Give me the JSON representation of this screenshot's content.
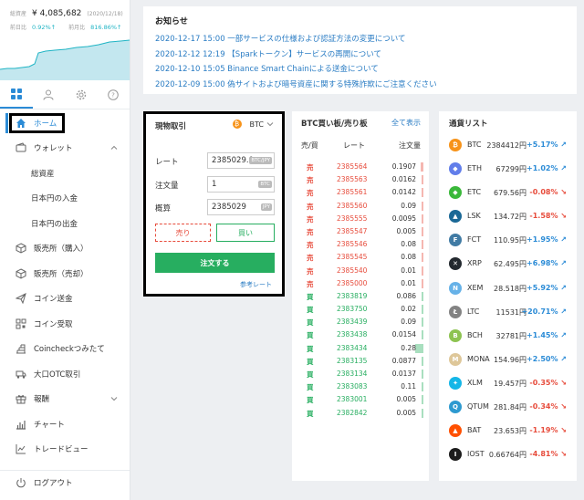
{
  "account": {
    "total_label": "総資産",
    "total_value": "¥ 4,085,682",
    "total_date": "(2020/12/18)",
    "day_label": "前日比",
    "day_pct": "0.92%↑",
    "month_label": "前月比",
    "month_pct": "816.86%↑"
  },
  "nav": {
    "home": "ホーム",
    "wallet": "ウォレット",
    "wallet_sub": [
      "総資産",
      "日本円の入金",
      "日本円の出金"
    ],
    "buy_shop": "販売所（購入）",
    "sell_shop": "販売所（売却）",
    "send": "コイン送金",
    "receive": "コイン受取",
    "tsumitate": "Coincheckつみたて",
    "otc": "大口OTC取引",
    "reward": "報酬",
    "chart": "チャート",
    "tradeview": "トレードビュー",
    "logout": "ログアウト"
  },
  "notice": {
    "title": "お知らせ",
    "items": [
      "2020-12-17 15:00 一部サービスの仕様および認証方法の変更について",
      "2020-12-12 12:19 【Sparkトークン】サービスの再開について",
      "2020-12-10 15:05 Binance Smart Chainによる送金について",
      "2020-12-09 15:00 偽サイトおよび暗号資産に関する特殊詐欺にご注意ください"
    ]
  },
  "trade": {
    "title": "現物取引",
    "coin": "BTC",
    "rate_label": "レート",
    "rate_value": "2385029.0",
    "rate_unit": "BTC/JPY",
    "qty_label": "注文量",
    "qty_value": "1",
    "qty_unit": "BTC",
    "conv_label": "概算",
    "conv_value": "2385029",
    "conv_unit": "JPY",
    "sell": "売り",
    "buy": "買い",
    "order": "注文する",
    "ref": "参考レート"
  },
  "book": {
    "title": "BTC買い板/売り板",
    "show_all": "全て表示",
    "col_side": "売/買",
    "col_rate": "レート",
    "col_qty": "注文量",
    "rows": [
      {
        "side": "売",
        "price": "2385564",
        "qty": "0.1907",
        "bar": 0.8
      },
      {
        "side": "売",
        "price": "2385563",
        "qty": "0.0162",
        "bar": 0.1
      },
      {
        "side": "売",
        "price": "2385561",
        "qty": "0.0142",
        "bar": 0.1
      },
      {
        "side": "売",
        "price": "2385560",
        "qty": "0.09",
        "bar": 0.5
      },
      {
        "side": "売",
        "price": "2385555",
        "qty": "0.0095",
        "bar": 0.1
      },
      {
        "side": "売",
        "price": "2385547",
        "qty": "0.005",
        "bar": 0.05
      },
      {
        "side": "売",
        "price": "2385546",
        "qty": "0.08",
        "bar": 0.45
      },
      {
        "side": "売",
        "price": "2385545",
        "qty": "0.08",
        "bar": 0.45
      },
      {
        "side": "売",
        "price": "2385540",
        "qty": "0.01",
        "bar": 0.1
      },
      {
        "side": "売",
        "price": "2385000",
        "qty": "0.01",
        "bar": 0.1
      },
      {
        "side": "買",
        "price": "2383819",
        "qty": "0.086",
        "bar": 0.5
      },
      {
        "side": "買",
        "price": "2383750",
        "qty": "0.02",
        "bar": 0.15
      },
      {
        "side": "買",
        "price": "2383439",
        "qty": "0.09",
        "bar": 0.5
      },
      {
        "side": "買",
        "price": "2383438",
        "qty": "0.0154",
        "bar": 0.1
      },
      {
        "side": "買",
        "price": "2383434",
        "qty": "0.28",
        "bar": 2.2
      },
      {
        "side": "買",
        "price": "2383135",
        "qty": "0.0877",
        "bar": 0.5
      },
      {
        "side": "買",
        "price": "2383134",
        "qty": "0.0137",
        "bar": 0.1
      },
      {
        "side": "買",
        "price": "2383083",
        "qty": "0.11",
        "bar": 0.6
      },
      {
        "side": "買",
        "price": "2383001",
        "qty": "0.005",
        "bar": 0.05
      },
      {
        "side": "買",
        "price": "2382842",
        "qty": "0.005",
        "bar": 0.05
      }
    ]
  },
  "currencies": {
    "title": "通貨リスト",
    "items": [
      {
        "sym": "BTC",
        "price": "2384412円",
        "chg": "+5.17%",
        "dir": "up",
        "color": "#f7931a",
        "icon": "bitcoin-icon",
        "glyph": "₿"
      },
      {
        "sym": "ETH",
        "price": "67299円",
        "chg": "+1.02%",
        "dir": "up",
        "color": "#627eea",
        "icon": "ethereum-icon",
        "glyph": "◆"
      },
      {
        "sym": "ETC",
        "price": "679.56円",
        "chg": "-0.08%",
        "dir": "down",
        "color": "#3ab83a",
        "icon": "ethereum-classic-icon",
        "glyph": "◆"
      },
      {
        "sym": "LSK",
        "price": "134.72円",
        "chg": "-1.58%",
        "dir": "down",
        "color": "#1a6896",
        "icon": "lisk-icon",
        "glyph": "▲"
      },
      {
        "sym": "FCT",
        "price": "110.95円",
        "chg": "+1.95%",
        "dir": "up",
        "color": "#417ba4",
        "icon": "factom-icon",
        "glyph": "F"
      },
      {
        "sym": "XRP",
        "price": "62.495円",
        "chg": "+6.98%",
        "dir": "up",
        "color": "#23292f",
        "icon": "ripple-icon",
        "glyph": "✕"
      },
      {
        "sym": "XEM",
        "price": "28.518円",
        "chg": "+5.92%",
        "dir": "up",
        "color": "#67b2e8",
        "icon": "nem-icon",
        "glyph": "N"
      },
      {
        "sym": "LTC",
        "price": "11531円",
        "chg": "+20.71%",
        "dir": "up",
        "color": "#838383",
        "icon": "litecoin-icon",
        "glyph": "Ł"
      },
      {
        "sym": "BCH",
        "price": "32781円",
        "chg": "+1.45%",
        "dir": "up",
        "color": "#8dc351",
        "icon": "bitcoin-cash-icon",
        "glyph": "B"
      },
      {
        "sym": "MONA",
        "price": "154.96円",
        "chg": "+2.50%",
        "dir": "up",
        "color": "#dec799",
        "icon": "monacoin-icon",
        "glyph": "M"
      },
      {
        "sym": "XLM",
        "price": "19.457円",
        "chg": "-0.35%",
        "dir": "down",
        "color": "#14b6e7",
        "icon": "stellar-icon",
        "glyph": "✦"
      },
      {
        "sym": "QTUM",
        "price": "281.84円",
        "chg": "-0.34%",
        "dir": "down",
        "color": "#2e9ad0",
        "icon": "qtum-icon",
        "glyph": "Q"
      },
      {
        "sym": "BAT",
        "price": "23.653円",
        "chg": "-1.19%",
        "dir": "down",
        "color": "#ff5000",
        "icon": "bat-icon",
        "glyph": "▲"
      },
      {
        "sym": "IOST",
        "price": "0.66764円",
        "chg": "-4.81%",
        "dir": "down",
        "color": "#1c1c1c",
        "icon": "iost-icon",
        "glyph": "I"
      }
    ]
  }
}
